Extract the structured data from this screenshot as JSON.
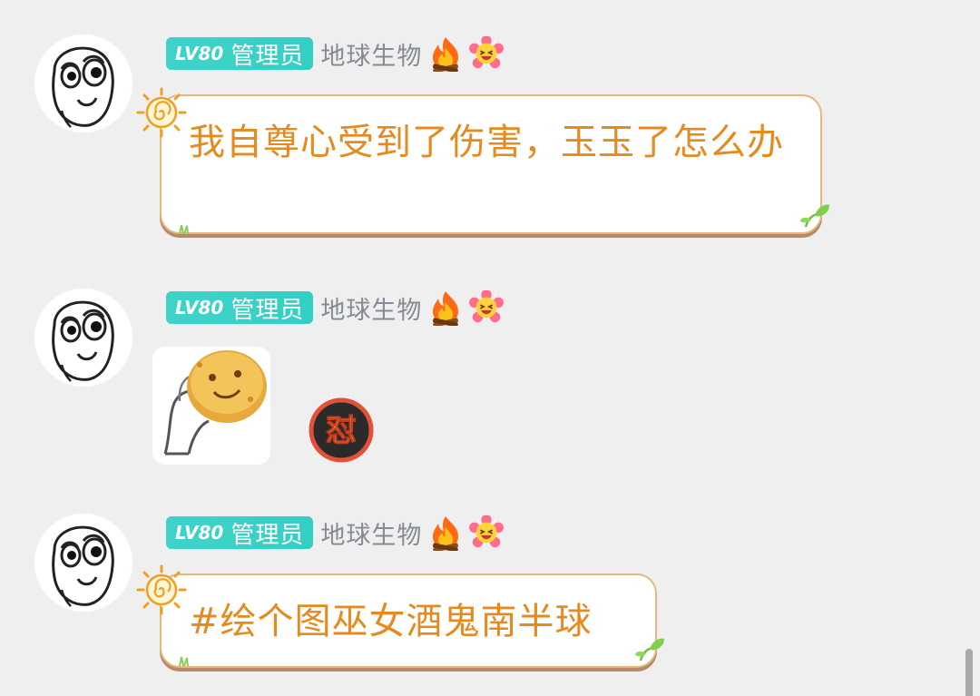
{
  "messages": [
    {
      "sender": {
        "level": "LV80",
        "role": "管理员",
        "name": "地球生物"
      },
      "type": "text",
      "text": "我自尊心受到了伤害，玉玉了怎么办"
    },
    {
      "sender": {
        "level": "LV80",
        "role": "管理员",
        "name": "地球生物"
      },
      "type": "sticker",
      "reaction": "怼"
    },
    {
      "sender": {
        "level": "LV80",
        "role": "管理员",
        "name": "地球生物"
      },
      "type": "text",
      "text": "#绘个图巫女酒鬼南半球"
    }
  ],
  "icons": {
    "avatar": "rage-face-avatar",
    "fire": "fire-icon",
    "flower": "smiling-flower-icon",
    "bubble_decoration": "sun-swirl-icon"
  },
  "colors": {
    "background": "#efefef",
    "badge": "#3fd3c8",
    "bubble_text": "#e58a1f",
    "bubble_border": "#e2b97a",
    "username": "#858b93"
  }
}
